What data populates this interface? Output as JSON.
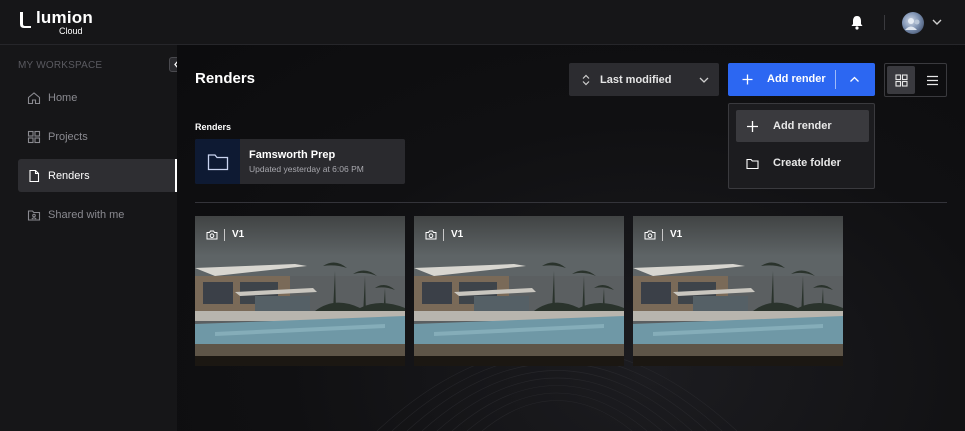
{
  "app": {
    "name": "lumion",
    "sub": "Cloud"
  },
  "sidebar": {
    "workspace_label": "MY WORKSPACE",
    "items": [
      {
        "label": "Home",
        "icon": "home-icon",
        "active": false
      },
      {
        "label": "Projects",
        "icon": "grid-icon",
        "active": false
      },
      {
        "label": "Renders",
        "icon": "file-icon",
        "active": true
      },
      {
        "label": "Shared with me",
        "icon": "shared-folder-icon",
        "active": false
      }
    ]
  },
  "header": {
    "title": "Renders"
  },
  "toolbar": {
    "sort_label": "Last modified",
    "add_label": "Add render"
  },
  "dropdown": {
    "items": [
      {
        "label": "Add render",
        "icon": "plus-icon"
      },
      {
        "label": "Create folder",
        "icon": "folder-icon"
      }
    ]
  },
  "folders_section": {
    "label": "Renders",
    "folder": {
      "name": "Famsworth Prep",
      "meta": "Updated yesterday at 6:06 PM"
    }
  },
  "renders": [
    {
      "version": "V1"
    },
    {
      "version": "V1"
    },
    {
      "version": "V1"
    }
  ],
  "colors": {
    "accent": "#2c67f2",
    "sidebar": "#161618",
    "active_item": "#2e2e32"
  }
}
